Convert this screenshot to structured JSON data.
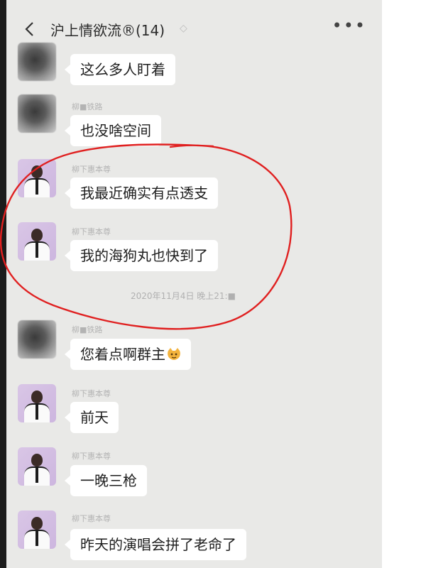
{
  "header": {
    "title": "沪上情欲流®(14)",
    "back_icon": "chevron-left-icon",
    "more_icon": "more-dots-icon"
  },
  "messages": [
    {
      "sender": "",
      "text": "这么多人盯着",
      "avatar": "blurred"
    },
    {
      "sender": "柳■铁路",
      "text": "也没啥空间",
      "avatar": "blurred"
    },
    {
      "sender": "柳下惠本尊",
      "text": "我最近确实有点透支",
      "avatar": "person"
    },
    {
      "sender": "柳下惠本尊",
      "text": "我的海狗丸也快到了",
      "avatar": "person"
    },
    {
      "sender": "柳■铁路",
      "text": "您着点啊群主",
      "avatar": "blurred",
      "emoji": "cat-face-emoji"
    },
    {
      "sender": "柳下惠本尊",
      "text": "前天",
      "avatar": "person"
    },
    {
      "sender": "柳下惠本尊",
      "text": "一晚三枪",
      "avatar": "person"
    },
    {
      "sender": "柳下惠本尊",
      "text": "昨天的演唱会拼了老命了",
      "avatar": "person"
    }
  ],
  "timestamp": "2020年11月4日 晚上21:■",
  "colors": {
    "annotation_circle": "#e02020",
    "bubble": "#ffffff",
    "chat_background": "#e9e9e7"
  }
}
